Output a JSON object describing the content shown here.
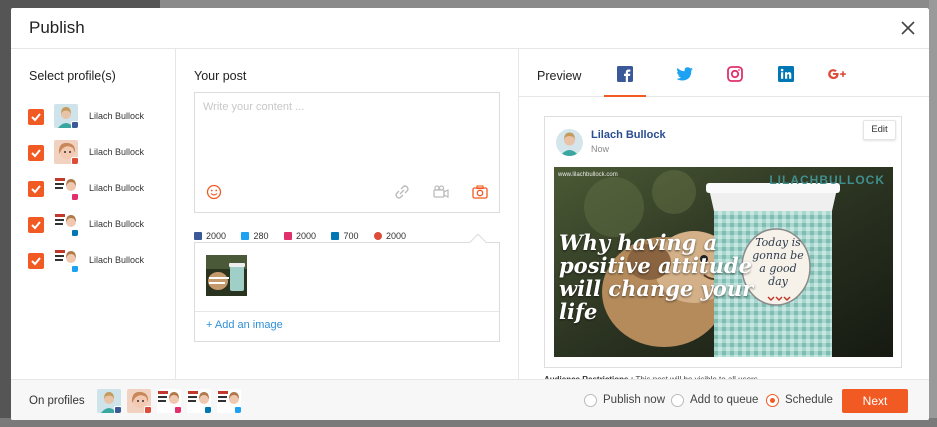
{
  "modal": {
    "title": "Publish"
  },
  "profiles": {
    "heading": "Select profile(s)",
    "items": [
      {
        "name": "Lilach Bullock",
        "network": "facebook-icon",
        "checked": true
      },
      {
        "name": "Lilach Bullock",
        "network": "google-plus-icon",
        "checked": true
      },
      {
        "name": "Lilach Bullock",
        "network": "instagram-icon",
        "checked": true
      },
      {
        "name": "Lilach Bullock",
        "network": "linkedin-icon",
        "checked": true
      },
      {
        "name": "Lilach Bullock",
        "network": "twitter-icon",
        "checked": true
      }
    ]
  },
  "post": {
    "heading": "Your post",
    "placeholder": "Write your content ...",
    "counts": [
      {
        "network": "facebook-icon",
        "value": "2000"
      },
      {
        "network": "twitter-icon",
        "value": "280"
      },
      {
        "network": "instagram-icon",
        "value": "2000"
      },
      {
        "network": "linkedin-icon",
        "value": "700"
      },
      {
        "network": "google-plus-icon",
        "value": "2000"
      }
    ],
    "add_image": "+ Add an image"
  },
  "preview": {
    "label": "Preview",
    "tabs": [
      "facebook-icon",
      "twitter-icon",
      "instagram-icon",
      "linkedin-icon",
      "google-plus-icon"
    ],
    "active_tab": "facebook-icon",
    "card": {
      "name": "Lilach Bullock",
      "time": "Now",
      "edit": "Edit",
      "image": {
        "url_text": "www.lilachbullock.com",
        "brand": "LILACHBULLOCK",
        "caption": "Why having a positive attitude will change your life",
        "cup_text": "Today is gonna be a good day"
      }
    },
    "restrictions_label": "Audience Restrictions :",
    "restrictions_text": "This post will be visible to all users."
  },
  "footer": {
    "on_profiles": "On profiles",
    "options": [
      {
        "label": "Publish now",
        "checked": false
      },
      {
        "label": "Add to queue",
        "checked": false
      },
      {
        "label": "Schedule",
        "checked": true
      }
    ],
    "next": "Next"
  },
  "colors": {
    "accent": "#f15a22",
    "facebook": "#3b5998",
    "twitter": "#1da1f2",
    "instagram": "#e1306c",
    "linkedin": "#0077b5",
    "google_plus": "#dd4b39"
  }
}
